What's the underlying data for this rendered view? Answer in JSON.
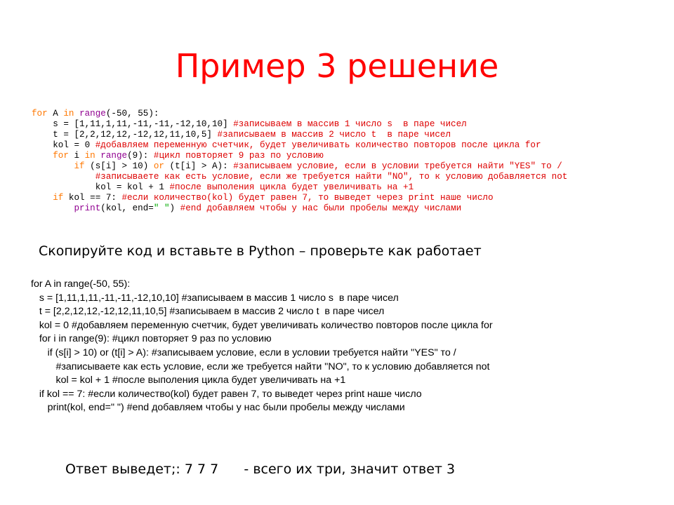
{
  "title": "Пример 3 решение",
  "colored_code": {
    "line1": {
      "kw_for": "for",
      "t1": " A ",
      "kw_in": "in",
      "t2": " ",
      "bi_range": "range",
      "t3": "(-50, 55):"
    },
    "line2": {
      "code": "    s = [1,11,1,11,-11,-11,-12,10,10] ",
      "comment": "#записываем в массив 1 число s  в паре чисел"
    },
    "line3": {
      "code": "    t = [2,2,12,12,-12,12,11,10,5] ",
      "comment": "#записываем в массив 2 число t  в паре чисел"
    },
    "line4": {
      "code": "    kol = 0 ",
      "comment": "#добавляем переменную счетчик, будет увеличивать количество повторов после цикла for"
    },
    "line5": {
      "indent": "    ",
      "kw_for": "for",
      "t1": " i ",
      "kw_in": "in",
      "t2": " ",
      "bi_range": "range",
      "t3": "(9): ",
      "comment": "#цикл повторяет 9 раз по условию"
    },
    "line6": {
      "indent": "        ",
      "kw_if": "if",
      "t1": " (s[i] > 10) ",
      "kw_or": "or",
      "t2": " (t[i] > A): ",
      "comment": "#записываем условие, если в условии требуется найти \"YES\" то /"
    },
    "line7": {
      "indent": "            ",
      "comment": "#записываете как есть условие, если же требуется найти \"NO\", то к условию добавляется not"
    },
    "line8": {
      "code": "            kol = kol + 1 ",
      "comment": "#после выполения цикла будет увеличивать на +1"
    },
    "line9": {
      "indent": "    ",
      "kw_if": "if",
      "t1": " kol == 7: ",
      "comment": "#если количество(kol) будет равен 7, то выведет через print наше число"
    },
    "line10": {
      "indent": "        ",
      "bi_print": "print",
      "t1": "(kol, end=",
      "str": "\" \"",
      "t2": ") ",
      "comment": "#end добавляем чтобы у нас были пробелы между числами"
    }
  },
  "instruction": "Скопируйте код и вставьте в Python – проверьте как работает",
  "plain_code": [
    "for A in range(-50, 55):",
    "   s = [1,11,1,11,-11,-11,-12,10,10] #записываем в массив 1 число s  в паре чисел",
    "   t = [2,2,12,12,-12,12,11,10,5] #записываем в массив 2 число t  в паре чисел",
    "   kol = 0 #добавляем переменную счетчик, будет увеличивать количество повторов после цикла for",
    "   for i in range(9): #цикл повторяет 9 раз по условию",
    "      if (s[i] > 10) or (t[i] > A): #записываем условие, если в условии требуется найти \"YES\" то /",
    "         #записываете как есть условие, если же требуется найти \"NO\", то к условию добавляется not",
    "         kol = kol + 1 #после выполения цикла будет увеличивать на +1",
    "   if kol == 7: #если количество(kol) будет равен 7, то выведет через print наше число",
    "      print(kol, end=\" \") #end добавляем чтобы у нас были пробелы между числами"
  ],
  "answer": "Ответ выведет;: 7 7 7      - всего их три, значит ответ 3",
  "colors": {
    "title": "#ff0000",
    "keyword": "#ff7700",
    "builtin": "#900090",
    "comment": "#dd0000",
    "string": "#00aa00"
  }
}
